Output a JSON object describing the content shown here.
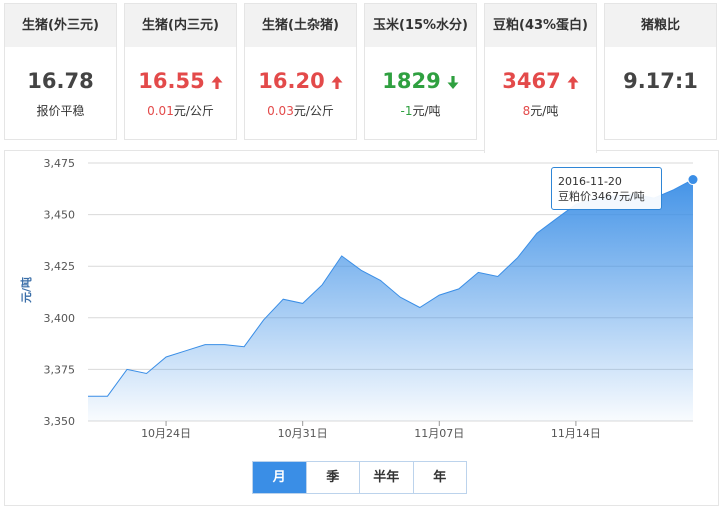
{
  "cards": [
    {
      "title": "生猪(外三元)",
      "value": "16.78",
      "direction": "flat",
      "sub_num": "",
      "sub_text": "报价平稳"
    },
    {
      "title": "生猪(内三元)",
      "value": "16.55",
      "direction": "up",
      "sub_num": "0.01",
      "sub_text": "元/公斤"
    },
    {
      "title": "生猪(土杂猪)",
      "value": "16.20",
      "direction": "up",
      "sub_num": "0.03",
      "sub_text": "元/公斤"
    },
    {
      "title": "玉米(15%水分)",
      "value": "1829",
      "direction": "down",
      "sub_num": "-1",
      "sub_text": "元/吨"
    },
    {
      "title": "豆粕(43%蛋白)",
      "value": "3467",
      "direction": "up",
      "sub_num": "8",
      "sub_text": "元/吨"
    },
    {
      "title": "猪粮比",
      "value": "9.17:1",
      "direction": "none",
      "sub_num": "",
      "sub_text": ""
    }
  ],
  "colors": {
    "up": "#e34a4a",
    "down": "#2fa040",
    "line": "#3a8ee6",
    "grid": "#d9d9d9",
    "active_tab": "#3a8ee6"
  },
  "icons": {
    "up": "arrow-up-icon",
    "down": "arrow-down-icon"
  },
  "tooltip": {
    "date": "2016-11-20",
    "label": "豆粕价3467元/吨"
  },
  "range_tabs": [
    {
      "label": "月",
      "active": true
    },
    {
      "label": "季",
      "active": false
    },
    {
      "label": "半年",
      "active": false
    },
    {
      "label": "年",
      "active": false
    }
  ],
  "chart_data": {
    "type": "area",
    "ylabel": "元/吨",
    "ylim": [
      3350,
      3475
    ],
    "yticks": [
      3350,
      3375,
      3400,
      3425,
      3450,
      3475
    ],
    "ytick_labels": [
      "3,350",
      "3,375",
      "3,400",
      "3,425",
      "3,450",
      "3,475"
    ],
    "xticks": [
      {
        "x": "2016-10-24",
        "label": "10月24日"
      },
      {
        "x": "2016-10-31",
        "label": "10月31日"
      },
      {
        "x": "2016-11-07",
        "label": "11月07日"
      },
      {
        "x": "2016-11-14",
        "label": "11月14日"
      }
    ],
    "grid": true,
    "series": [
      {
        "x": [
          "2016-10-20",
          "2016-10-21",
          "2016-10-22",
          "2016-10-23",
          "2016-10-24",
          "2016-10-25",
          "2016-10-26",
          "2016-10-27",
          "2016-10-28",
          "2016-10-29",
          "2016-10-30",
          "2016-10-31",
          "2016-11-01",
          "2016-11-02",
          "2016-11-03",
          "2016-11-04",
          "2016-11-05",
          "2016-11-06",
          "2016-11-07",
          "2016-11-08",
          "2016-11-09",
          "2016-11-10",
          "2016-11-11",
          "2016-11-12",
          "2016-11-13",
          "2016-11-14",
          "2016-11-15",
          "2016-11-16",
          "2016-11-17",
          "2016-11-18",
          "2016-11-19",
          "2016-11-20"
        ],
        "values": [
          3362,
          3362,
          3375,
          3373,
          3381,
          3384,
          3387,
          3387,
          3386,
          3399,
          3409,
          3407,
          3416,
          3430,
          3423,
          3418,
          3410,
          3405,
          3411,
          3414,
          3422,
          3420,
          3429,
          3441,
          3448,
          3455,
          3458,
          3459,
          3460,
          3458,
          3462,
          3467
        ]
      }
    ]
  }
}
